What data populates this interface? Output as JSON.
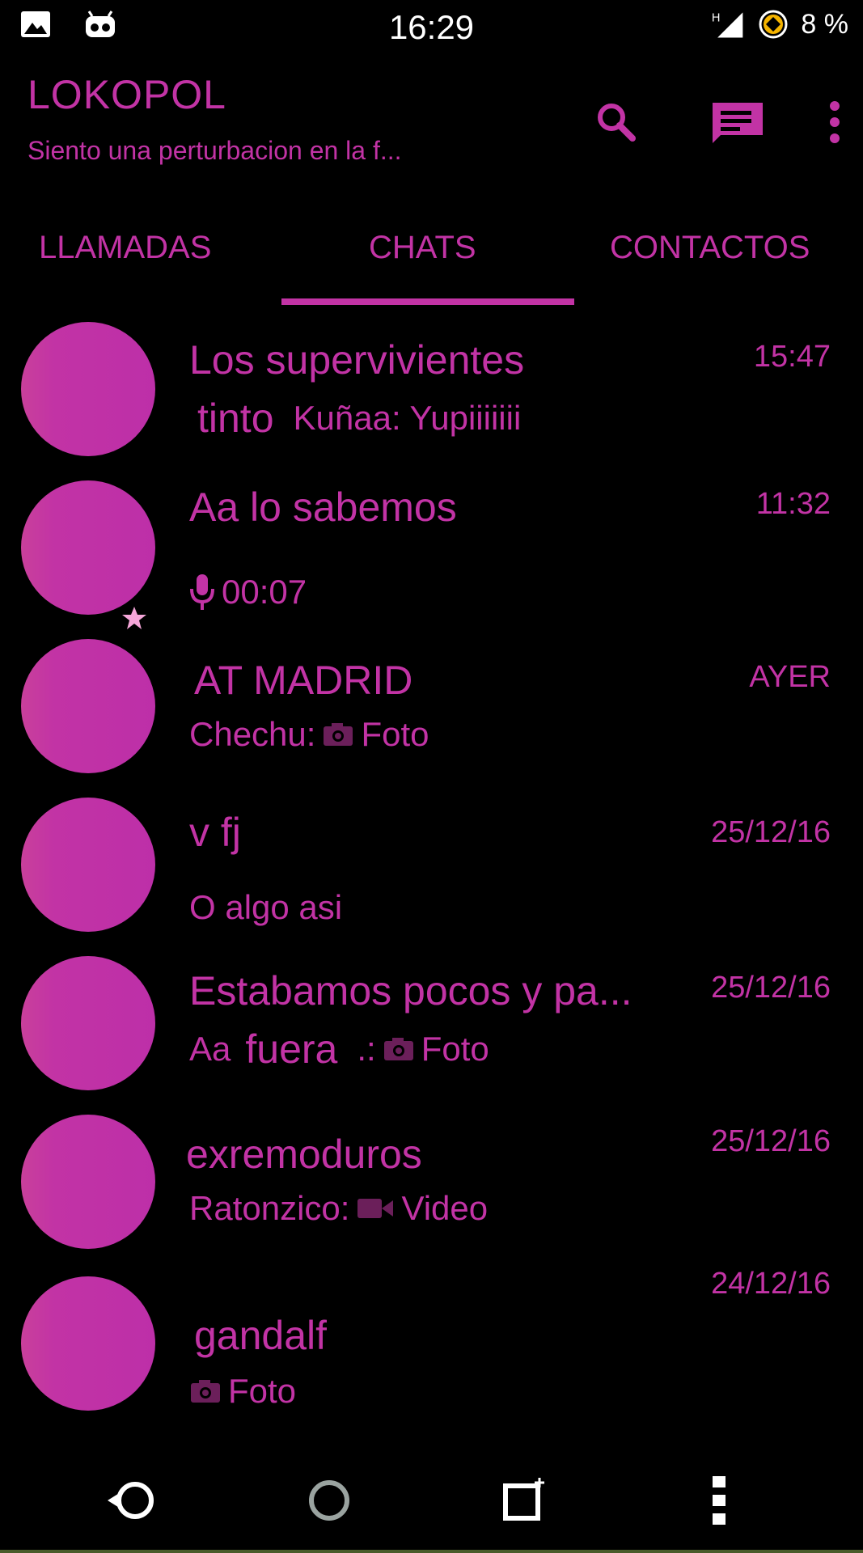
{
  "status_bar": {
    "time": "16:29",
    "battery": "8 %",
    "icons": [
      "image-icon",
      "android-icon",
      "signal-h-icon",
      "data-saver-icon"
    ]
  },
  "header": {
    "title": "LOKOPOL",
    "subtitle": "Siento una perturbacion en la f...",
    "actions": [
      "search-icon",
      "new-chat-icon",
      "more-vert-icon"
    ]
  },
  "tabs": [
    {
      "label": "LLAMADAS",
      "selected": false
    },
    {
      "label": "CHATS",
      "selected": true
    },
    {
      "label": "CONTACTOS",
      "selected": false
    }
  ],
  "chats": [
    {
      "name": "Los supervivientes",
      "time": "15:47",
      "preview_bold": "tinto",
      "preview": "Kuñaa: Yupiiiiiii"
    },
    {
      "name": "Aa lo sabemos",
      "time": "11:32",
      "preview": "00:07",
      "preview_icon": "mic-icon",
      "starred": true
    },
    {
      "name": "AT MADRID",
      "time": "AYER",
      "preview_prefix": "Chechu:",
      "preview_icon": "camera-icon",
      "preview": "Foto"
    },
    {
      "name": "v fj",
      "time": "25/12/16",
      "preview": "O algo asi"
    },
    {
      "name": "Estabamos pocos y pa...",
      "time": "25/12/16",
      "preview_prefix": "Aa",
      "preview_bold": "fuera",
      "preview_sep": ".:",
      "preview_icon": "camera-icon",
      "preview": "Foto"
    },
    {
      "name": "exremoduros",
      "time": "25/12/16",
      "preview_prefix": "Ratonzico:",
      "preview_icon": "video-icon",
      "preview": "Video"
    },
    {
      "name": "gandalf",
      "time": "24/12/16",
      "preview_icon": "camera-icon",
      "preview": "Foto"
    }
  ],
  "nav": [
    "back-icon",
    "home-icon",
    "recents-icon",
    "menu-icon"
  ],
  "colors": {
    "accent": "#c233a5",
    "background": "#000000",
    "icon_muted": "#6b1f5a"
  }
}
